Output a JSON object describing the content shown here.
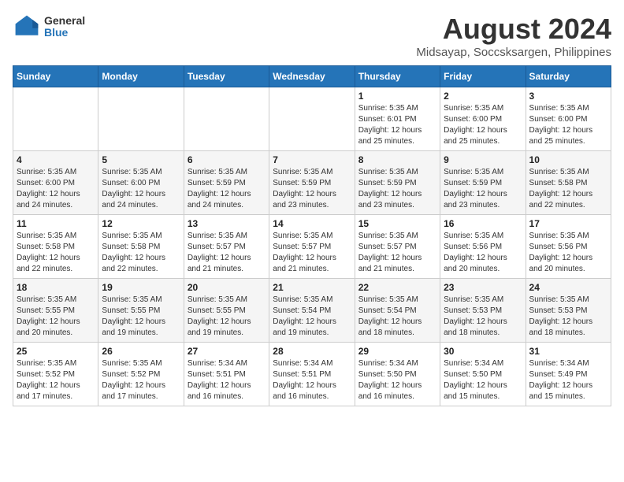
{
  "logo": {
    "general": "General",
    "blue": "Blue"
  },
  "header": {
    "month_year": "August 2024",
    "location": "Midsayap, Soccsksargen, Philippines"
  },
  "weekdays": [
    "Sunday",
    "Monday",
    "Tuesday",
    "Wednesday",
    "Thursday",
    "Friday",
    "Saturday"
  ],
  "weeks": [
    [
      {
        "day": "",
        "info": ""
      },
      {
        "day": "",
        "info": ""
      },
      {
        "day": "",
        "info": ""
      },
      {
        "day": "",
        "info": ""
      },
      {
        "day": "1",
        "info": "Sunrise: 5:35 AM\nSunset: 6:01 PM\nDaylight: 12 hours\nand 25 minutes."
      },
      {
        "day": "2",
        "info": "Sunrise: 5:35 AM\nSunset: 6:00 PM\nDaylight: 12 hours\nand 25 minutes."
      },
      {
        "day": "3",
        "info": "Sunrise: 5:35 AM\nSunset: 6:00 PM\nDaylight: 12 hours\nand 25 minutes."
      }
    ],
    [
      {
        "day": "4",
        "info": "Sunrise: 5:35 AM\nSunset: 6:00 PM\nDaylight: 12 hours\nand 24 minutes."
      },
      {
        "day": "5",
        "info": "Sunrise: 5:35 AM\nSunset: 6:00 PM\nDaylight: 12 hours\nand 24 minutes."
      },
      {
        "day": "6",
        "info": "Sunrise: 5:35 AM\nSunset: 5:59 PM\nDaylight: 12 hours\nand 24 minutes."
      },
      {
        "day": "7",
        "info": "Sunrise: 5:35 AM\nSunset: 5:59 PM\nDaylight: 12 hours\nand 23 minutes."
      },
      {
        "day": "8",
        "info": "Sunrise: 5:35 AM\nSunset: 5:59 PM\nDaylight: 12 hours\nand 23 minutes."
      },
      {
        "day": "9",
        "info": "Sunrise: 5:35 AM\nSunset: 5:59 PM\nDaylight: 12 hours\nand 23 minutes."
      },
      {
        "day": "10",
        "info": "Sunrise: 5:35 AM\nSunset: 5:58 PM\nDaylight: 12 hours\nand 22 minutes."
      }
    ],
    [
      {
        "day": "11",
        "info": "Sunrise: 5:35 AM\nSunset: 5:58 PM\nDaylight: 12 hours\nand 22 minutes."
      },
      {
        "day": "12",
        "info": "Sunrise: 5:35 AM\nSunset: 5:58 PM\nDaylight: 12 hours\nand 22 minutes."
      },
      {
        "day": "13",
        "info": "Sunrise: 5:35 AM\nSunset: 5:57 PM\nDaylight: 12 hours\nand 21 minutes."
      },
      {
        "day": "14",
        "info": "Sunrise: 5:35 AM\nSunset: 5:57 PM\nDaylight: 12 hours\nand 21 minutes."
      },
      {
        "day": "15",
        "info": "Sunrise: 5:35 AM\nSunset: 5:57 PM\nDaylight: 12 hours\nand 21 minutes."
      },
      {
        "day": "16",
        "info": "Sunrise: 5:35 AM\nSunset: 5:56 PM\nDaylight: 12 hours\nand 20 minutes."
      },
      {
        "day": "17",
        "info": "Sunrise: 5:35 AM\nSunset: 5:56 PM\nDaylight: 12 hours\nand 20 minutes."
      }
    ],
    [
      {
        "day": "18",
        "info": "Sunrise: 5:35 AM\nSunset: 5:55 PM\nDaylight: 12 hours\nand 20 minutes."
      },
      {
        "day": "19",
        "info": "Sunrise: 5:35 AM\nSunset: 5:55 PM\nDaylight: 12 hours\nand 19 minutes."
      },
      {
        "day": "20",
        "info": "Sunrise: 5:35 AM\nSunset: 5:55 PM\nDaylight: 12 hours\nand 19 minutes."
      },
      {
        "day": "21",
        "info": "Sunrise: 5:35 AM\nSunset: 5:54 PM\nDaylight: 12 hours\nand 19 minutes."
      },
      {
        "day": "22",
        "info": "Sunrise: 5:35 AM\nSunset: 5:54 PM\nDaylight: 12 hours\nand 18 minutes."
      },
      {
        "day": "23",
        "info": "Sunrise: 5:35 AM\nSunset: 5:53 PM\nDaylight: 12 hours\nand 18 minutes."
      },
      {
        "day": "24",
        "info": "Sunrise: 5:35 AM\nSunset: 5:53 PM\nDaylight: 12 hours\nand 18 minutes."
      }
    ],
    [
      {
        "day": "25",
        "info": "Sunrise: 5:35 AM\nSunset: 5:52 PM\nDaylight: 12 hours\nand 17 minutes."
      },
      {
        "day": "26",
        "info": "Sunrise: 5:35 AM\nSunset: 5:52 PM\nDaylight: 12 hours\nand 17 minutes."
      },
      {
        "day": "27",
        "info": "Sunrise: 5:34 AM\nSunset: 5:51 PM\nDaylight: 12 hours\nand 16 minutes."
      },
      {
        "day": "28",
        "info": "Sunrise: 5:34 AM\nSunset: 5:51 PM\nDaylight: 12 hours\nand 16 minutes."
      },
      {
        "day": "29",
        "info": "Sunrise: 5:34 AM\nSunset: 5:50 PM\nDaylight: 12 hours\nand 16 minutes."
      },
      {
        "day": "30",
        "info": "Sunrise: 5:34 AM\nSunset: 5:50 PM\nDaylight: 12 hours\nand 15 minutes."
      },
      {
        "day": "31",
        "info": "Sunrise: 5:34 AM\nSunset: 5:49 PM\nDaylight: 12 hours\nand 15 minutes."
      }
    ]
  ]
}
